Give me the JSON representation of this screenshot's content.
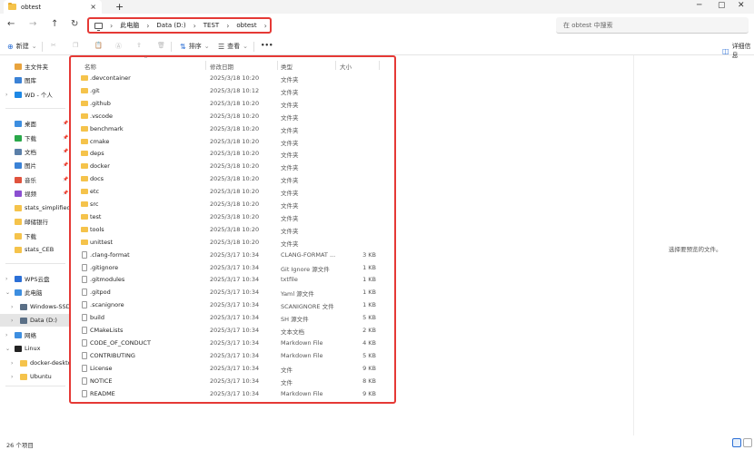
{
  "window": {
    "tab_title": "obtest",
    "tab_close": "×",
    "new_tab": "+",
    "minimize": "─",
    "maximize": "▢",
    "close": "✕"
  },
  "nav": {
    "back": "←",
    "forward": "→",
    "up": "↑",
    "refresh": "↻",
    "breadcrumbs": [
      "此电脑",
      "Data (D:)",
      "TEST",
      "obtest"
    ],
    "search_placeholder": "在 obtest 中搜索"
  },
  "commands": {
    "new_label": "新建",
    "sort_label": "排序",
    "view_label": "查看",
    "more_label": "•••",
    "details_label": "详细信息"
  },
  "sidebar": {
    "items": [
      {
        "label": "主文件夹",
        "icon": "home-icon",
        "color": "#e8a33d"
      },
      {
        "label": "图库",
        "icon": "gallery-icon",
        "color": "#3b82d6"
      },
      {
        "label": "WD - 个人",
        "icon": "cloud-icon",
        "color": "#1e88e5"
      },
      {
        "label": "桌面",
        "icon": "desktop-icon",
        "color": "#3d8ee0"
      },
      {
        "label": "下载",
        "icon": "download-icon",
        "color": "#2aa84a"
      },
      {
        "label": "文档",
        "icon": "document-icon",
        "color": "#5b7fa8"
      },
      {
        "label": "图片",
        "icon": "pictures-icon",
        "color": "#3b82d6"
      },
      {
        "label": "音乐",
        "icon": "music-icon",
        "color": "#e0533d"
      },
      {
        "label": "视频",
        "icon": "video-icon",
        "color": "#8b4fd1"
      },
      {
        "label": "stats_simplified",
        "icon": "folder-icon",
        "color": "#f5c34b"
      },
      {
        "label": "邮储银行",
        "icon": "folder-icon",
        "color": "#f5c34b"
      },
      {
        "label": "下载",
        "icon": "folder-icon",
        "color": "#f5c34b"
      },
      {
        "label": "stats_CEB",
        "icon": "folder-icon",
        "color": "#f5c34b"
      },
      {
        "label": "WPS云盘",
        "icon": "cloud-icon",
        "color": "#2b6fd6"
      },
      {
        "label": "此电脑",
        "icon": "pc-icon",
        "color": "#3d8ee0"
      },
      {
        "label": "Windows-SSD (C",
        "icon": "drive-icon",
        "color": "#5a6f86"
      },
      {
        "label": "Data (D:)",
        "icon": "drive-icon",
        "color": "#5a6f86"
      },
      {
        "label": "网络",
        "icon": "network-icon",
        "color": "#3d8ee0"
      },
      {
        "label": "Linux",
        "icon": "linux-icon",
        "color": "#222"
      },
      {
        "label": "docker-desktop",
        "icon": "folder-icon",
        "color": "#f5c34b"
      },
      {
        "label": "Ubuntu",
        "icon": "folder-icon",
        "color": "#f5c34b"
      }
    ]
  },
  "columns": {
    "name": "名称",
    "date": "修改日期",
    "type": "类型",
    "size": "大小"
  },
  "files": [
    {
      "name": ".devcontainer",
      "date": "2025/3/18 10:20",
      "type": "文件夹",
      "size": "",
      "kind": "folder"
    },
    {
      "name": ".git",
      "date": "2025/3/18 10:12",
      "type": "文件夹",
      "size": "",
      "kind": "folder"
    },
    {
      "name": ".github",
      "date": "2025/3/18 10:20",
      "type": "文件夹",
      "size": "",
      "kind": "folder"
    },
    {
      "name": ".vscode",
      "date": "2025/3/18 10:20",
      "type": "文件夹",
      "size": "",
      "kind": "folder"
    },
    {
      "name": "benchmark",
      "date": "2025/3/18 10:20",
      "type": "文件夹",
      "size": "",
      "kind": "folder"
    },
    {
      "name": "cmake",
      "date": "2025/3/18 10:20",
      "type": "文件夹",
      "size": "",
      "kind": "folder"
    },
    {
      "name": "deps",
      "date": "2025/3/18 10:20",
      "type": "文件夹",
      "size": "",
      "kind": "folder"
    },
    {
      "name": "docker",
      "date": "2025/3/18 10:20",
      "type": "文件夹",
      "size": "",
      "kind": "folder"
    },
    {
      "name": "docs",
      "date": "2025/3/18 10:20",
      "type": "文件夹",
      "size": "",
      "kind": "folder"
    },
    {
      "name": "etc",
      "date": "2025/3/18 10:20",
      "type": "文件夹",
      "size": "",
      "kind": "folder"
    },
    {
      "name": "src",
      "date": "2025/3/18 10:20",
      "type": "文件夹",
      "size": "",
      "kind": "folder"
    },
    {
      "name": "test",
      "date": "2025/3/18 10:20",
      "type": "文件夹",
      "size": "",
      "kind": "folder"
    },
    {
      "name": "tools",
      "date": "2025/3/18 10:20",
      "type": "文件夹",
      "size": "",
      "kind": "folder"
    },
    {
      "name": "unittest",
      "date": "2025/3/18 10:20",
      "type": "文件夹",
      "size": "",
      "kind": "folder"
    },
    {
      "name": ".clang-format",
      "date": "2025/3/17 10:34",
      "type": "CLANG-FORMAT ...",
      "size": "3 KB",
      "kind": "file"
    },
    {
      "name": ".gitignore",
      "date": "2025/3/17 10:34",
      "type": "Git Ignore 源文件",
      "size": "1 KB",
      "kind": "file"
    },
    {
      "name": ".gitmodules",
      "date": "2025/3/17 10:34",
      "type": "txtfile",
      "size": "1 KB",
      "kind": "file"
    },
    {
      "name": ".gitpod",
      "date": "2025/3/17 10:34",
      "type": "Yaml 源文件",
      "size": "1 KB",
      "kind": "file"
    },
    {
      "name": ".scanignore",
      "date": "2025/3/17 10:34",
      "type": "SCANIGNORE 文件",
      "size": "1 KB",
      "kind": "file"
    },
    {
      "name": "build",
      "date": "2025/3/17 10:34",
      "type": "SH 源文件",
      "size": "5 KB",
      "kind": "file"
    },
    {
      "name": "CMakeLists",
      "date": "2025/3/17 10:34",
      "type": "文本文档",
      "size": "2 KB",
      "kind": "file"
    },
    {
      "name": "CODE_OF_CONDUCT",
      "date": "2025/3/17 10:34",
      "type": "Markdown File",
      "size": "4 KB",
      "kind": "file"
    },
    {
      "name": "CONTRIBUTING",
      "date": "2025/3/17 10:34",
      "type": "Markdown File",
      "size": "5 KB",
      "kind": "file"
    },
    {
      "name": "License",
      "date": "2025/3/17 10:34",
      "type": "文件",
      "size": "9 KB",
      "kind": "file"
    },
    {
      "name": "NOTICE",
      "date": "2025/3/17 10:34",
      "type": "文件",
      "size": "8 KB",
      "kind": "file"
    },
    {
      "name": "README",
      "date": "2025/3/17 10:34",
      "type": "Markdown File",
      "size": "9 KB",
      "kind": "file"
    }
  ],
  "preview": {
    "empty_text": "选择要预览的文件。"
  },
  "status": {
    "item_count": "26 个项目"
  }
}
